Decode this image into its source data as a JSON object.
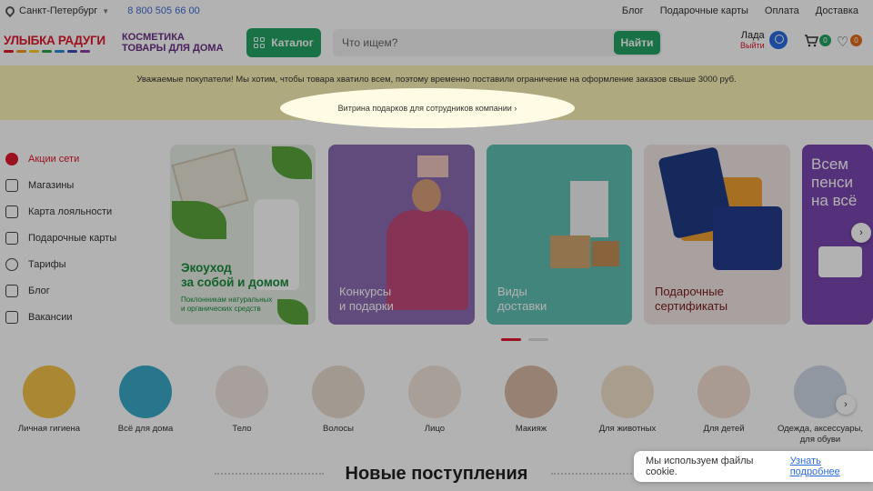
{
  "topbar": {
    "city": "Санкт-Петербург",
    "phone": "8 800 505 66 00",
    "links": [
      "Блог",
      "Подарочные карты",
      "Оплата",
      "Доставка"
    ]
  },
  "header": {
    "logo": "УЛЫБКА РАДУГИ",
    "logo_sub_1": "КОСМЕТИКА",
    "logo_sub_2": "ТОВАРЫ ДЛЯ ДОМА",
    "catalog": "Каталог",
    "search_placeholder": "Что ищем?",
    "search_button": "Найти",
    "user_name": "Лада",
    "logout": "Выйти",
    "cart_count": "0",
    "fav_count": "0"
  },
  "notice": {
    "text": "Уважаемые покупатели! Мы хотим, чтобы товара хватило всем, поэтому временно поставили ограничение на оформление заказов свыше 3000 руб.",
    "gift_link": "Витрина подарков для сотрудников компании"
  },
  "sidebar": {
    "items": [
      {
        "label": "Акции сети",
        "icon": "percent-icon"
      },
      {
        "label": "Магазины",
        "icon": "basket-icon"
      },
      {
        "label": "Карта лояльности",
        "icon": "card-icon"
      },
      {
        "label": "Подарочные карты",
        "icon": "gift-icon"
      },
      {
        "label": "Тарифы",
        "icon": "tariff-icon"
      },
      {
        "label": "Блог",
        "icon": "book-icon"
      },
      {
        "label": "Вакансии",
        "icon": "briefcase-icon"
      }
    ]
  },
  "banners": {
    "b1_title_1": "Экоуход",
    "b1_title_2": "за собой и домом",
    "b1_sub_1": "Поклонникам натуральных",
    "b1_sub_2": "и органических средств",
    "b2_title_1": "Конкурсы",
    "b2_title_2": "и подарки",
    "b3_title_1": "Виды",
    "b3_title_2": "доставки",
    "b4_title_1": "Подарочные",
    "b4_title_2": "сертификаты",
    "b5_title_1": "Всем",
    "b5_title_2": "пенси",
    "b5_title_3": "на всё"
  },
  "categories": [
    {
      "label": "Личная гигиена",
      "color": "#f2c24a"
    },
    {
      "label": "Всё для дома",
      "color": "#39a9c7"
    },
    {
      "label": "Тело",
      "color": "#efe6e0"
    },
    {
      "label": "Волосы",
      "color": "#e9dccf"
    },
    {
      "label": "Лицо",
      "color": "#f1e4dc"
    },
    {
      "label": "Макияж",
      "color": "#d9b9a4"
    },
    {
      "label": "Для животных",
      "color": "#f3e2cc"
    },
    {
      "label": "Для детей",
      "color": "#f4dfd2"
    },
    {
      "label": "Одежда, аксессуары,",
      "label2": "для обуви",
      "color": "#cfd8e6"
    }
  ],
  "section_heading": "Новые поступления",
  "cookie": {
    "text": "Мы используем файлы cookie.",
    "link": "Узнать подробнее"
  },
  "colors": {
    "brand_red": "#e0172d",
    "brand_green": "#23a464",
    "notice_bg": "#fbf2b8"
  }
}
